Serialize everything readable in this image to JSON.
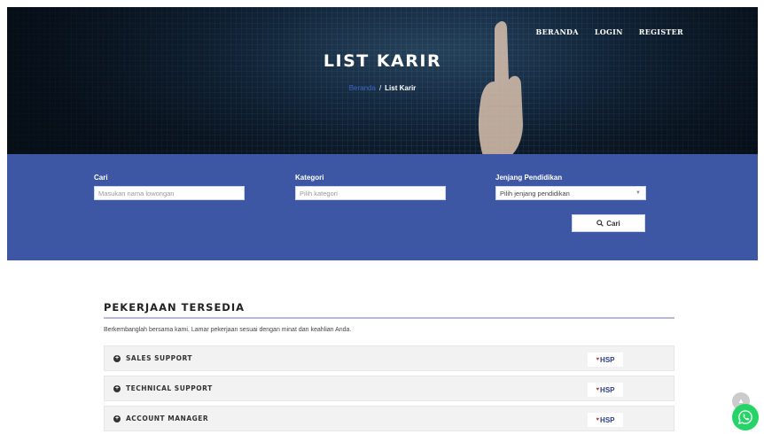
{
  "nav": {
    "items": [
      "BERANDA",
      "LOGIN",
      "REGISTER"
    ]
  },
  "hero": {
    "title": "LIST KARIR",
    "crumb_home": "Beranda",
    "crumb_sep": "/",
    "crumb_current": "List Karir"
  },
  "search": {
    "cari_label": "Cari",
    "cari_placeholder": "Masukan nama lowongan",
    "kategori_label": "Kategori",
    "kategori_placeholder": "Pilih kategori",
    "jenjang_label": "Jenjang Pendidikan",
    "jenjang_value": "Pilih jenjang pendidikan",
    "button_label": "Cari"
  },
  "jobs": {
    "title": "PEKERJAAN TERSEDIA",
    "description": "Berkembanglah bersama kami. Lamar pekerjaan sesuai dengan minat dan keahlian Anda.",
    "items": [
      {
        "name": "SALES SUPPORT",
        "company_logo": "HSP"
      },
      {
        "name": "TECHNICAL SUPPORT",
        "company_logo": "HSP"
      },
      {
        "name": "ACCOUNT MANAGER",
        "company_logo": "HSP"
      }
    ]
  },
  "colors": {
    "search_bg": "#3d57a5",
    "link": "#3d66c7",
    "whatsapp": "#25d366"
  },
  "icons": {
    "search": "magnifier-icon",
    "expand": "plus-circle-icon",
    "whatsapp": "whatsapp-icon",
    "scroll_top": "chevron-up-icon"
  }
}
